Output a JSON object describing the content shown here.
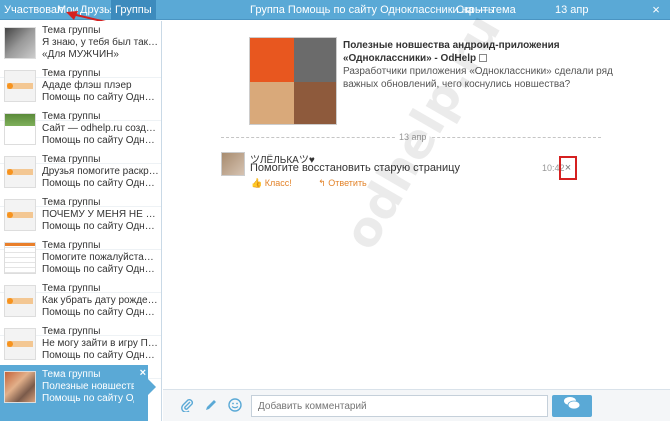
{
  "tabs": {
    "participated": "Участвовал",
    "mine": "Мои",
    "friends": "Друзья",
    "groups": "Группы"
  },
  "header": {
    "title": "Группа Помощь по сайту Одноклассники на — тема",
    "close_label": "Скрыть",
    "date": "13 апр",
    "close_icon": "×"
  },
  "conversations": [
    {
      "thumb": "photo",
      "title": "Тема группы",
      "line2": "Я знаю, у тебя был так…",
      "line3": "«Для МУЖЧИН»"
    },
    {
      "thumb": "logo",
      "title": "Тема группы",
      "line2": "Ададе флэш плэер",
      "line3": "Помощь по сайту Одн…"
    },
    {
      "thumb": "site",
      "title": "Тема группы",
      "line2": "Сайт — odhelp.ru созд…",
      "line3": "Помощь по сайту Одн…"
    },
    {
      "thumb": "logo",
      "title": "Тема группы",
      "line2": "Друзья помогите раскр…",
      "line3": "Помощь по сайту Одн…"
    },
    {
      "thumb": "logo",
      "title": "Тема группы",
      "line2": "ПОЧЕМУ У МЕНЯ НЕ …",
      "line3": "Помощь по сайту Одн…"
    },
    {
      "thumb": "listing",
      "title": "Тема группы",
      "line2": "Помогите пожалуйста…",
      "line3": "Помощь по сайту Одн…"
    },
    {
      "thumb": "logo",
      "title": "Тема группы",
      "line2": "Как убрать дату рожде…",
      "line3": "Помощь по сайту Одн…"
    },
    {
      "thumb": "logo",
      "title": "Тема группы",
      "line2": "Не могу зайти в игру П…",
      "line3": "Помощь по сайту Одн…"
    },
    {
      "thumb": "collage",
      "title": "Тема группы",
      "line2": "Полезные новшества…",
      "line3": "Помощь по сайту Одна…",
      "active": true
    }
  ],
  "post": {
    "title": "Полезные новшества андроид-приложения «Одноклассники» - OdHelp",
    "description": "Разработчики приложения «Одноклассники» сделали ряд важных обновлений, чего коснулись новшества?"
  },
  "thread": {
    "date_label": "13 апр",
    "sender": "ツЛЁЛЬКАツ♥",
    "message": "Помогите восстановить старую страницу",
    "like_label": "Класс!",
    "reply_label": "Ответить",
    "time": "10:42",
    "delete_icon": "×"
  },
  "watermark": "odhelp.ru",
  "composer": {
    "placeholder": "Добавить комментарий",
    "attach_icon": "paperclip-icon",
    "pencil_icon": "pencil-icon",
    "smile_icon": "smile-icon",
    "send_icon": "send-icon"
  },
  "colors": {
    "accent": "#5aa9d6",
    "highlight_red": "#d52020",
    "action_orange": "#e3842b"
  }
}
